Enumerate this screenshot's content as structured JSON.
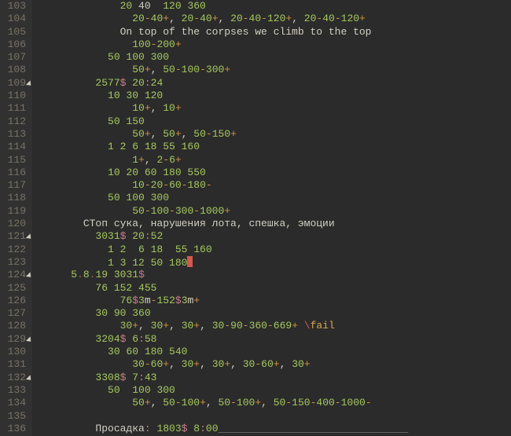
{
  "gutter": {
    "start": 103,
    "end": 136,
    "fold_lines": [
      109,
      121,
      124,
      129,
      132
    ]
  },
  "code": [
    {
      "indent": 12,
      "spans": [
        {
          "cls": "s-green",
          "text": "20 "
        },
        {
          "cls": "s-text",
          "text": "40  "
        },
        {
          "cls": "s-green",
          "text": "120 360"
        }
      ]
    },
    {
      "indent": 14,
      "spans": [
        {
          "cls": "s-green",
          "text": "20"
        },
        {
          "cls": "s-orange",
          "text": "-"
        },
        {
          "cls": "s-green",
          "text": "40"
        },
        {
          "cls": "s-orange",
          "text": "+"
        },
        {
          "cls": "s-text",
          "text": ", "
        },
        {
          "cls": "s-green",
          "text": "20"
        },
        {
          "cls": "s-orange",
          "text": "-"
        },
        {
          "cls": "s-green",
          "text": "40"
        },
        {
          "cls": "s-orange",
          "text": "+"
        },
        {
          "cls": "s-text",
          "text": ", "
        },
        {
          "cls": "s-green",
          "text": "20"
        },
        {
          "cls": "s-orange",
          "text": "-"
        },
        {
          "cls": "s-green",
          "text": "40"
        },
        {
          "cls": "s-orange",
          "text": "-"
        },
        {
          "cls": "s-green",
          "text": "120"
        },
        {
          "cls": "s-orange",
          "text": "+"
        },
        {
          "cls": "s-text",
          "text": ", "
        },
        {
          "cls": "s-green",
          "text": "20"
        },
        {
          "cls": "s-orange",
          "text": "-"
        },
        {
          "cls": "s-green",
          "text": "40"
        },
        {
          "cls": "s-orange",
          "text": "-"
        },
        {
          "cls": "s-green",
          "text": "120"
        },
        {
          "cls": "s-orange",
          "text": "+"
        }
      ]
    },
    {
      "indent": 12,
      "spans": [
        {
          "cls": "s-text",
          "text": "On top of the corpses we climb to the top"
        }
      ]
    },
    {
      "indent": 14,
      "spans": [
        {
          "cls": "s-green",
          "text": "100"
        },
        {
          "cls": "s-orange",
          "text": "-"
        },
        {
          "cls": "s-green",
          "text": "200"
        },
        {
          "cls": "s-orange",
          "text": "+"
        }
      ]
    },
    {
      "indent": 10,
      "spans": [
        {
          "cls": "s-green",
          "text": "50 100 300"
        }
      ]
    },
    {
      "indent": 14,
      "spans": [
        {
          "cls": "s-green",
          "text": "50"
        },
        {
          "cls": "s-orange",
          "text": "+"
        },
        {
          "cls": "s-text",
          "text": ", "
        },
        {
          "cls": "s-green",
          "text": "50"
        },
        {
          "cls": "s-orange",
          "text": "-"
        },
        {
          "cls": "s-green",
          "text": "100"
        },
        {
          "cls": "s-orange",
          "text": "-"
        },
        {
          "cls": "s-green",
          "text": "300"
        },
        {
          "cls": "s-orange",
          "text": "+"
        }
      ]
    },
    {
      "indent": 8,
      "spans": [
        {
          "cls": "s-green",
          "text": "2577"
        },
        {
          "cls": "s-pink",
          "text": "$ "
        },
        {
          "cls": "s-green",
          "text": "20"
        },
        {
          "cls": "s-pink",
          "text": ":"
        },
        {
          "cls": "s-green",
          "text": "24"
        }
      ]
    },
    {
      "indent": 10,
      "spans": [
        {
          "cls": "s-green",
          "text": "10 30 120"
        }
      ]
    },
    {
      "indent": 14,
      "spans": [
        {
          "cls": "s-green",
          "text": "10"
        },
        {
          "cls": "s-orange",
          "text": "+"
        },
        {
          "cls": "s-text",
          "text": ", "
        },
        {
          "cls": "s-green",
          "text": "10"
        },
        {
          "cls": "s-orange",
          "text": "+"
        }
      ]
    },
    {
      "indent": 10,
      "spans": [
        {
          "cls": "s-green",
          "text": "50 150"
        }
      ]
    },
    {
      "indent": 14,
      "spans": [
        {
          "cls": "s-green",
          "text": "50"
        },
        {
          "cls": "s-orange",
          "text": "+"
        },
        {
          "cls": "s-text",
          "text": ", "
        },
        {
          "cls": "s-green",
          "text": "50"
        },
        {
          "cls": "s-orange",
          "text": "+"
        },
        {
          "cls": "s-text",
          "text": ", "
        },
        {
          "cls": "s-green",
          "text": "50"
        },
        {
          "cls": "s-orange",
          "text": "-"
        },
        {
          "cls": "s-green",
          "text": "150"
        },
        {
          "cls": "s-orange",
          "text": "+"
        }
      ]
    },
    {
      "indent": 10,
      "spans": [
        {
          "cls": "s-green",
          "text": "1 2 6 18 55 160"
        }
      ]
    },
    {
      "indent": 14,
      "spans": [
        {
          "cls": "s-green",
          "text": "1"
        },
        {
          "cls": "s-orange",
          "text": "+"
        },
        {
          "cls": "s-text",
          "text": ", "
        },
        {
          "cls": "s-green",
          "text": "2"
        },
        {
          "cls": "s-orange",
          "text": "-"
        },
        {
          "cls": "s-green",
          "text": "6"
        },
        {
          "cls": "s-orange",
          "text": "+"
        }
      ]
    },
    {
      "indent": 10,
      "spans": [
        {
          "cls": "s-green",
          "text": "10 20 60 180 550"
        }
      ]
    },
    {
      "indent": 14,
      "spans": [
        {
          "cls": "s-green",
          "text": "10"
        },
        {
          "cls": "s-orange",
          "text": "-"
        },
        {
          "cls": "s-green",
          "text": "20"
        },
        {
          "cls": "s-orange",
          "text": "-"
        },
        {
          "cls": "s-green",
          "text": "60"
        },
        {
          "cls": "s-orange",
          "text": "-"
        },
        {
          "cls": "s-green",
          "text": "180"
        },
        {
          "cls": "s-orange",
          "text": "-"
        }
      ]
    },
    {
      "indent": 10,
      "spans": [
        {
          "cls": "s-green",
          "text": "50 100 300"
        }
      ]
    },
    {
      "indent": 14,
      "spans": [
        {
          "cls": "s-green",
          "text": "50"
        },
        {
          "cls": "s-orange",
          "text": "-"
        },
        {
          "cls": "s-green",
          "text": "100"
        },
        {
          "cls": "s-orange",
          "text": "-"
        },
        {
          "cls": "s-green",
          "text": "300"
        },
        {
          "cls": "s-orange",
          "text": "-"
        },
        {
          "cls": "s-green",
          "text": "1000"
        },
        {
          "cls": "s-orange",
          "text": "+"
        }
      ]
    },
    {
      "indent": 6,
      "spans": [
        {
          "cls": "s-text",
          "text": "СТоп сука, нарушения лота, спешка, эмоции"
        }
      ]
    },
    {
      "indent": 8,
      "spans": [
        {
          "cls": "s-green",
          "text": "3031"
        },
        {
          "cls": "s-pink",
          "text": "$ "
        },
        {
          "cls": "s-green",
          "text": "20"
        },
        {
          "cls": "s-pink",
          "text": ":"
        },
        {
          "cls": "s-green",
          "text": "52"
        }
      ]
    },
    {
      "indent": 10,
      "spans": [
        {
          "cls": "s-green",
          "text": "1 2  6 18  55 160"
        }
      ]
    },
    {
      "indent": 10,
      "spans": [
        {
          "cls": "s-green",
          "text": "1 3 12 50 180"
        },
        {
          "cls": "cursor",
          "text": ""
        }
      ]
    },
    {
      "indent": 4,
      "spans": [
        {
          "cls": "s-green",
          "text": "5"
        },
        {
          "cls": "s-brown",
          "text": "."
        },
        {
          "cls": "s-green",
          "text": "8"
        },
        {
          "cls": "s-brown",
          "text": "."
        },
        {
          "cls": "s-green",
          "text": "19 3031"
        },
        {
          "cls": "s-pink",
          "text": "$"
        }
      ]
    },
    {
      "indent": 8,
      "spans": [
        {
          "cls": "s-green",
          "text": "76 152 455"
        }
      ]
    },
    {
      "indent": 12,
      "spans": [
        {
          "cls": "s-green",
          "text": "76"
        },
        {
          "cls": "s-pink",
          "text": "$"
        },
        {
          "cls": "s-green",
          "text": "3"
        },
        {
          "cls": "s-text",
          "text": "m"
        },
        {
          "cls": "s-orange",
          "text": "-"
        },
        {
          "cls": "s-green",
          "text": "152"
        },
        {
          "cls": "s-pink",
          "text": "$"
        },
        {
          "cls": "s-green",
          "text": "3"
        },
        {
          "cls": "s-text",
          "text": "m"
        },
        {
          "cls": "s-orange",
          "text": "+"
        }
      ]
    },
    {
      "indent": 8,
      "spans": [
        {
          "cls": "s-green",
          "text": "30 90 360"
        }
      ]
    },
    {
      "indent": 12,
      "spans": [
        {
          "cls": "s-green",
          "text": "30"
        },
        {
          "cls": "s-orange",
          "text": "+"
        },
        {
          "cls": "s-text",
          "text": ", "
        },
        {
          "cls": "s-green",
          "text": "30"
        },
        {
          "cls": "s-orange",
          "text": "+"
        },
        {
          "cls": "s-text",
          "text": ", "
        },
        {
          "cls": "s-green",
          "text": "30"
        },
        {
          "cls": "s-orange",
          "text": "+"
        },
        {
          "cls": "s-text",
          "text": ", "
        },
        {
          "cls": "s-green",
          "text": "30"
        },
        {
          "cls": "s-orange",
          "text": "-"
        },
        {
          "cls": "s-green",
          "text": "90"
        },
        {
          "cls": "s-orange",
          "text": "-"
        },
        {
          "cls": "s-green",
          "text": "360"
        },
        {
          "cls": "s-orange",
          "text": "-"
        },
        {
          "cls": "s-green",
          "text": "669"
        },
        {
          "cls": "s-orange",
          "text": "+ "
        },
        {
          "cls": "s-red",
          "text": "\\"
        },
        {
          "cls": "s-yellow",
          "text": "fail"
        }
      ]
    },
    {
      "indent": 8,
      "spans": [
        {
          "cls": "s-green",
          "text": "3204"
        },
        {
          "cls": "s-pink",
          "text": "$ "
        },
        {
          "cls": "s-green",
          "text": "6"
        },
        {
          "cls": "s-pink",
          "text": ":"
        },
        {
          "cls": "s-green",
          "text": "58"
        }
      ]
    },
    {
      "indent": 10,
      "spans": [
        {
          "cls": "s-green",
          "text": "30 60 180 540"
        }
      ]
    },
    {
      "indent": 14,
      "spans": [
        {
          "cls": "s-green",
          "text": "30"
        },
        {
          "cls": "s-orange",
          "text": "-"
        },
        {
          "cls": "s-green",
          "text": "60"
        },
        {
          "cls": "s-orange",
          "text": "+"
        },
        {
          "cls": "s-text",
          "text": ", "
        },
        {
          "cls": "s-green",
          "text": "30"
        },
        {
          "cls": "s-orange",
          "text": "+"
        },
        {
          "cls": "s-text",
          "text": ", "
        },
        {
          "cls": "s-green",
          "text": "30"
        },
        {
          "cls": "s-orange",
          "text": "+"
        },
        {
          "cls": "s-text",
          "text": ", "
        },
        {
          "cls": "s-green",
          "text": "30"
        },
        {
          "cls": "s-orange",
          "text": "-"
        },
        {
          "cls": "s-green",
          "text": "60"
        },
        {
          "cls": "s-orange",
          "text": "+"
        },
        {
          "cls": "s-text",
          "text": ", "
        },
        {
          "cls": "s-green",
          "text": "30"
        },
        {
          "cls": "s-orange",
          "text": "+"
        }
      ]
    },
    {
      "indent": 8,
      "spans": [
        {
          "cls": "s-green",
          "text": "3308"
        },
        {
          "cls": "s-pink",
          "text": "$ "
        },
        {
          "cls": "s-green",
          "text": "7"
        },
        {
          "cls": "s-pink",
          "text": ":"
        },
        {
          "cls": "s-green",
          "text": "43"
        }
      ]
    },
    {
      "indent": 10,
      "spans": [
        {
          "cls": "s-green",
          "text": "50 "
        },
        {
          "cls": "s-text",
          "text": " "
        },
        {
          "cls": "s-green",
          "text": "100 300"
        }
      ]
    },
    {
      "indent": 14,
      "spans": [
        {
          "cls": "s-green",
          "text": "50"
        },
        {
          "cls": "s-orange",
          "text": "+"
        },
        {
          "cls": "s-text",
          "text": ", "
        },
        {
          "cls": "s-green",
          "text": "50"
        },
        {
          "cls": "s-orange",
          "text": "-"
        },
        {
          "cls": "s-green",
          "text": "100"
        },
        {
          "cls": "s-orange",
          "text": "+"
        },
        {
          "cls": "s-text",
          "text": ", "
        },
        {
          "cls": "s-green",
          "text": "50"
        },
        {
          "cls": "s-orange",
          "text": "-"
        },
        {
          "cls": "s-green",
          "text": "100"
        },
        {
          "cls": "s-orange",
          "text": "+"
        },
        {
          "cls": "s-text",
          "text": ", "
        },
        {
          "cls": "s-green",
          "text": "50"
        },
        {
          "cls": "s-orange",
          "text": "-"
        },
        {
          "cls": "s-green",
          "text": "150"
        },
        {
          "cls": "s-orange",
          "text": "-"
        },
        {
          "cls": "s-green",
          "text": "400"
        },
        {
          "cls": "s-orange",
          "text": "-"
        },
        {
          "cls": "s-green",
          "text": "1000"
        },
        {
          "cls": "s-orange",
          "text": "-"
        }
      ]
    },
    {
      "indent": 0,
      "spans": []
    },
    {
      "indent": 8,
      "spans": [
        {
          "cls": "s-text",
          "text": "Просадка"
        },
        {
          "cls": "s-pink",
          "text": ": "
        },
        {
          "cls": "s-green",
          "text": "1803"
        },
        {
          "cls": "s-pink",
          "text": "$ "
        },
        {
          "cls": "s-green",
          "text": "8"
        },
        {
          "cls": "s-pink",
          "text": ":"
        },
        {
          "cls": "s-green",
          "text": "00"
        },
        {
          "cls": "s-gray",
          "text": "_______________________________"
        }
      ]
    }
  ]
}
